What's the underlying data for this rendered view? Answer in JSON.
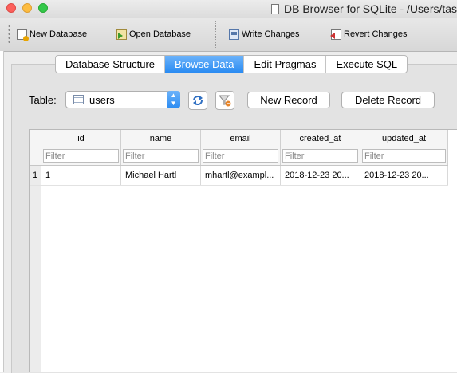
{
  "window": {
    "title": "DB Browser for SQLite - /Users/tasu"
  },
  "toolbar": {
    "new_database": "New Database",
    "open_database": "Open Database",
    "write_changes": "Write Changes",
    "revert_changes": "Revert Changes"
  },
  "tabs": [
    {
      "label": "Database Structure",
      "active": false
    },
    {
      "label": "Browse Data",
      "active": true
    },
    {
      "label": "Edit Pragmas",
      "active": false
    },
    {
      "label": "Execute SQL",
      "active": false
    }
  ],
  "browse": {
    "table_label": "Table:",
    "selected_table": "users",
    "new_record": "New Record",
    "delete_record": "Delete Record"
  },
  "grid": {
    "columns": [
      "id",
      "name",
      "email",
      "created_at",
      "updated_at"
    ],
    "filter_placeholder": "Filter",
    "rows": [
      {
        "row_number": "1",
        "cells": [
          "1",
          "Michael Hartl",
          "mhartl@exampl...",
          "2018-12-23 20...",
          "2018-12-23 20..."
        ]
      }
    ]
  },
  "colors": {
    "accent": "#2a8bf2"
  }
}
